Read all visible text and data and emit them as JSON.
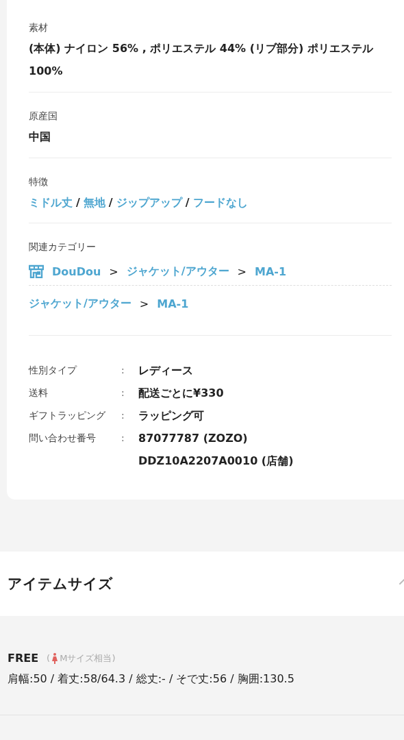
{
  "material": {
    "label": "素材",
    "value": "(本体) ナイロン 56% , ポリエステル 44% (リブ部分) ポリエステル 100%"
  },
  "origin": {
    "label": "原産国",
    "value": "中国"
  },
  "features": {
    "label": "特徴",
    "separator": "/",
    "tags": [
      "ミドル丈",
      "無地",
      "ジップアップ",
      "フードなし"
    ]
  },
  "related": {
    "label": "関連カテゴリー",
    "paths": [
      {
        "kind": "shop",
        "separator": ">",
        "items": [
          "DouDou",
          "ジャケット/アウター",
          "MA-1"
        ]
      },
      {
        "kind": "category",
        "separator": ">",
        "items": [
          "ジャケット/アウター",
          "MA-1"
        ]
      }
    ]
  },
  "specs": [
    {
      "label": "性別タイプ",
      "colon": ":",
      "values": [
        "レディース"
      ]
    },
    {
      "label": "送料",
      "colon": ":",
      "values": [
        "配送ごとに¥330"
      ]
    },
    {
      "label": "ギフトラッピング",
      "colon": ":",
      "values": [
        "ラッピング可"
      ]
    },
    {
      "label": "問い合わせ番号",
      "colon": ":",
      "values": [
        "87077787 (ZOZO)",
        "DDZ10A2207A0010 (店舗)"
      ]
    }
  ],
  "item_size": {
    "title": "アイテムサイズ",
    "expanded": true
  },
  "sizes": [
    {
      "name": "FREE",
      "open": "(",
      "equivalent": "Mサイズ相当)",
      "measurements": "肩幅:50 / 着丈:58/64.3 / 総丈:- / そで丈:56 / 胸囲:130.5"
    }
  ]
}
